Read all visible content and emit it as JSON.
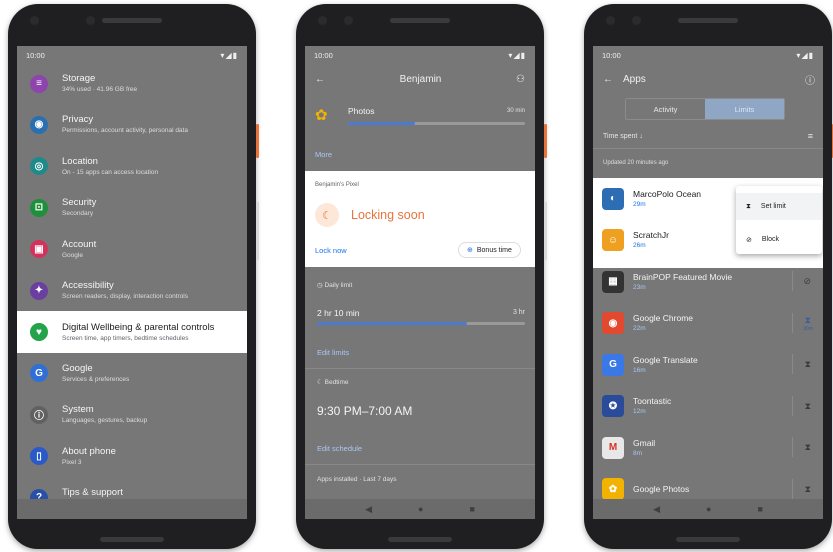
{
  "phone1": {
    "status_time": "10:00",
    "status_icons": "▾◢▮",
    "items": [
      {
        "title": "Storage",
        "subtitle": "34% used · 41.96 GB free",
        "icon": "storage-icon",
        "glyph": "≡",
        "color": "#8e44ad"
      },
      {
        "title": "Privacy",
        "subtitle": "Permissions, account activity, personal data",
        "icon": "privacy-icon",
        "glyph": "◉",
        "color": "#2a6fb0"
      },
      {
        "title": "Location",
        "subtitle": "On - 15 apps can access location",
        "icon": "location-icon",
        "glyph": "◎",
        "color": "#1f8a8a"
      },
      {
        "title": "Security",
        "subtitle": "Secondary",
        "icon": "lock-icon",
        "glyph": "⊡",
        "color": "#1e8f3a"
      },
      {
        "title": "Account",
        "subtitle": "Google",
        "icon": "account-icon",
        "glyph": "▣",
        "color": "#d2335c"
      },
      {
        "title": "Accessibility",
        "subtitle": "Screen readers, display, interaction controls",
        "icon": "accessibility-icon",
        "glyph": "✦",
        "color": "#6a3fa0"
      },
      {
        "title": "Digital Wellbeing & parental controls",
        "subtitle": "Screen time, app timers, bedtime schedules",
        "icon": "wellbeing-icon",
        "glyph": "♥",
        "color": "#23a34a"
      },
      {
        "title": "Google",
        "subtitle": "Services & preferences",
        "icon": "google-icon",
        "glyph": "G",
        "color": "#2f6fd6"
      },
      {
        "title": "System",
        "subtitle": "Languages, gestures, backup",
        "icon": "system-icon",
        "glyph": "ⓘ",
        "color": "#616161"
      },
      {
        "title": "About phone",
        "subtitle": "Pixel 3",
        "icon": "phone-icon",
        "glyph": "▯",
        "color": "#2a5ac8"
      },
      {
        "title": "Tips & support",
        "subtitle": "Help articles, phone & chat, getting started",
        "icon": "help-icon",
        "glyph": "?",
        "color": "#2a4fa8"
      }
    ]
  },
  "phone2": {
    "status_time": "10:00",
    "status_icons": "▾◢▮",
    "title": "Benjamin",
    "photos_label": "Photos",
    "photos_time": "30 min",
    "photos_progress": 0.38,
    "more_link": "More",
    "card_label": "Benjamin's Pixel",
    "locking_text": "Locking soon",
    "lock_now": "Lock now",
    "bonus_time": "Bonus time",
    "daily_limit_label": "Daily limit",
    "daily_limit_value": "2 hr 10 min",
    "daily_limit_max": "3 hr",
    "daily_limit_progress": 0.72,
    "edit_limits": "Edit limits",
    "bedtime_label": "Bedtime",
    "bedtime_value": "9:30 PM–7:00 AM",
    "edit_schedule": "Edit schedule",
    "apps_installed": "Apps installed · Last 7 days"
  },
  "phone3": {
    "status_time": "10:00",
    "status_icons": "▾◢▮",
    "title": "Apps",
    "tab_activity": "Activity",
    "tab_limits": "Limits",
    "time_spent": "Time spent",
    "updated": "Updated 20 minutes ago",
    "menu_set_limit": "Set limit",
    "menu_block": "Block",
    "apps": [
      {
        "name": "MarcoPolo Ocean",
        "time": "29m",
        "color": "#2d6db3",
        "glyph": "◐"
      },
      {
        "name": "ScratchJr",
        "time": "26m",
        "color": "#f0a020",
        "glyph": "☺"
      },
      {
        "name": "BrainPOP Featured Movie",
        "time": "23m",
        "color": "#333333",
        "glyph": "▦",
        "action": "⊘"
      },
      {
        "name": "Google Chrome",
        "time": "22m",
        "color": "#e24a2f",
        "glyph": "◉",
        "action": "⧗",
        "action_sub": "30m"
      },
      {
        "name": "Google Translate",
        "time": "16m",
        "color": "#3b78e7",
        "glyph": "G",
        "action": "⧗"
      },
      {
        "name": "Toontastic",
        "time": "12m",
        "color": "#2a4a9a",
        "glyph": "✪",
        "action": "⧗"
      },
      {
        "name": "Gmail",
        "time": "8m",
        "color": "#e8e8e8",
        "glyph": "M",
        "action": "⧗"
      },
      {
        "name": "Google Photos",
        "time": "",
        "color": "#f2b300",
        "glyph": "✿",
        "action": "⧗"
      }
    ]
  }
}
